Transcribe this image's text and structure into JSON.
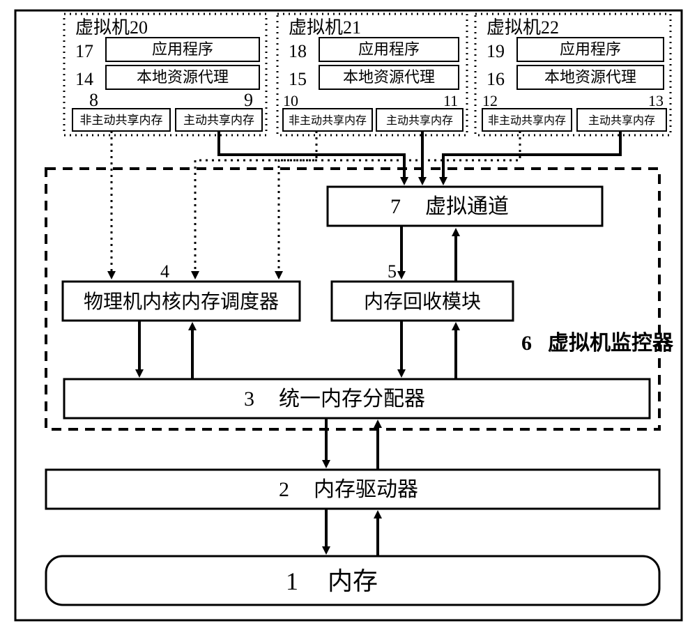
{
  "vm20": {
    "title": "虚拟机20",
    "app_num": "17",
    "app_label": "应用程序",
    "proxy_num": "14",
    "proxy_label": "本地资源代理",
    "nonactive_num": "8",
    "nonactive_label": "非主动共享内存",
    "active_num": "9",
    "active_label": "主动共享内存"
  },
  "vm21": {
    "title": "虚拟机21",
    "app_num": "18",
    "app_label": "应用程序",
    "proxy_num": "15",
    "proxy_label": "本地资源代理",
    "nonactive_num": "10",
    "nonactive_label": "非主动共享内存",
    "active_num": "11",
    "active_label": "主动共享内存"
  },
  "vm22": {
    "title": "虚拟机22",
    "app_num": "19",
    "app_label": "应用程序",
    "proxy_num": "16",
    "proxy_label": "本地资源代理",
    "nonactive_num": "12",
    "nonactive_label": "非主动共享内存",
    "active_num": "13",
    "active_label": "主动共享内存"
  },
  "vchannel": {
    "num": "7",
    "label": "虚拟通道"
  },
  "scheduler": {
    "num": "4",
    "label": "物理机内核内存调度器"
  },
  "recycler": {
    "num": "5",
    "label": "内存回收模块"
  },
  "monitor": {
    "num": "6",
    "label": "虚拟机监控器"
  },
  "allocator": {
    "num": "3",
    "label": "统一内存分配器"
  },
  "driver": {
    "num": "2",
    "label": "内存驱动器"
  },
  "memory": {
    "num": "1",
    "label": "内存"
  }
}
